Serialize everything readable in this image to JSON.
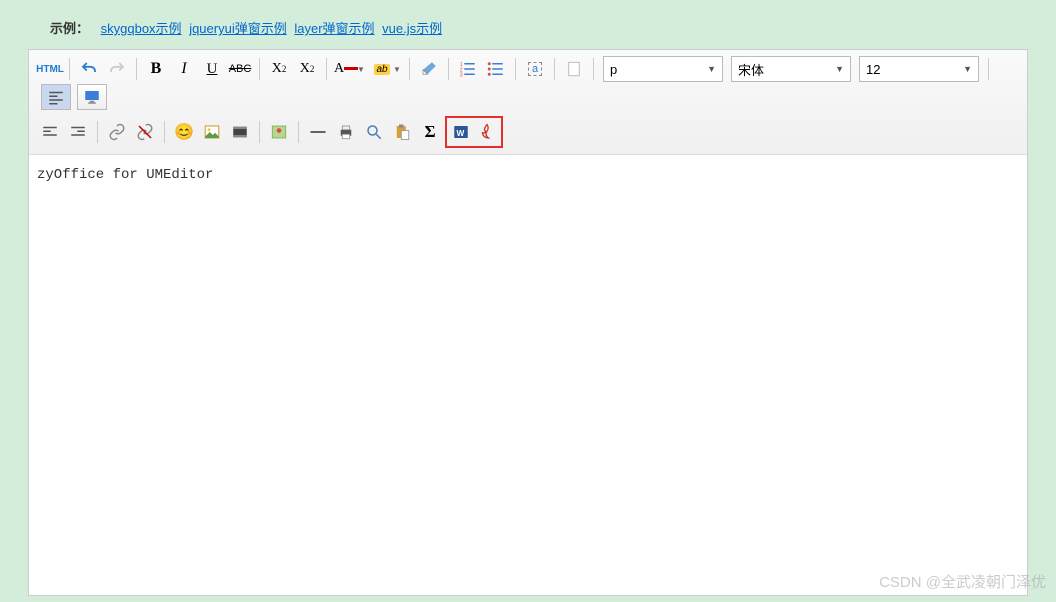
{
  "header": {
    "label": "示例：",
    "links": [
      "skygqbox示例",
      "jqueryui弹窗示例",
      "layer弹窗示例",
      "vue.js示例"
    ]
  },
  "toolbar": {
    "html_label": "HTML",
    "paragraph": "p",
    "font_family": "宋体",
    "font_size": "12"
  },
  "content": {
    "text": "zyOffice for UMEditor"
  },
  "watermark": "CSDN @全武凌朝门泽优"
}
